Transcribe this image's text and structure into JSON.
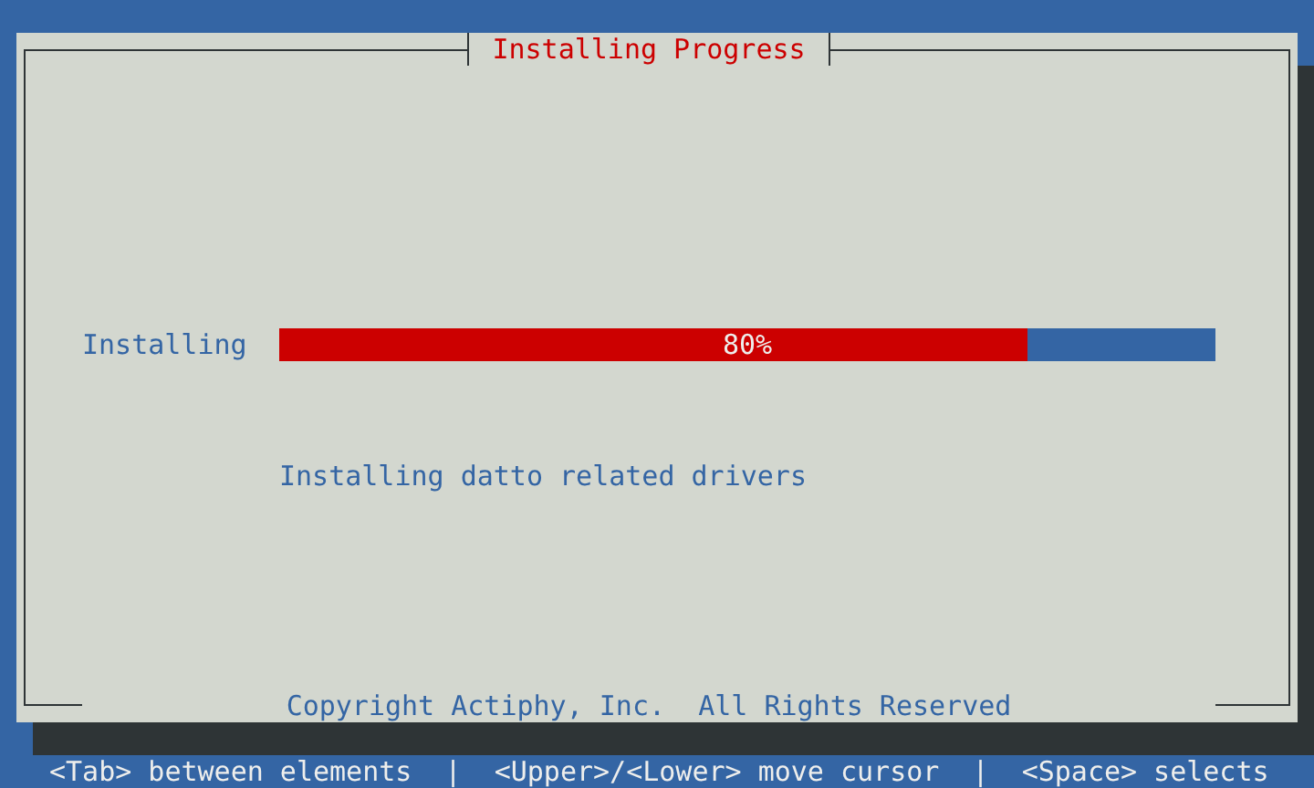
{
  "dialog": {
    "title": "Installing Progress",
    "progress": {
      "label": "Installing",
      "level": 0.8,
      "reading": "80%"
    },
    "message": "Installing datto related drivers",
    "footer": "Copyright Actiphy, Inc.  All Rights Reserved"
  },
  "status_bar": "<Tab> between elements  |  <Upper>/<Lower> move cursor  |  <Space> selects"
}
